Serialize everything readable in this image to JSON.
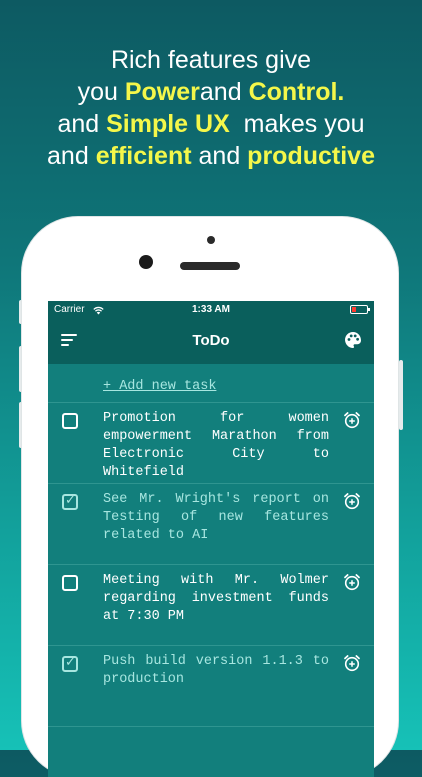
{
  "headline": {
    "line1": "Rich features give",
    "line2_a": "you ",
    "line2_power": "Power",
    "line2_b": "and ",
    "line2_control": "Control.",
    "line3_a": "and ",
    "line3_simple": "Simple UX",
    "line3_b": "  makes you",
    "line4_a": "and ",
    "line4_efficient": "efficient",
    "line4_b": " and ",
    "line4_productive": "productive"
  },
  "statusbar": {
    "carrier": "Carrier",
    "time": "1:33 AM"
  },
  "navbar": {
    "title": "ToDo",
    "menu_icon": "menu-icon",
    "palette_icon": "palette-icon"
  },
  "add_task": "+ Add new task",
  "tasks": [
    {
      "text": "Promotion for women empowerment Marathon from Electronic City to Whitefield",
      "done": false
    },
    {
      "text": "See Mr. Wright's report on Testing of new features related to AI",
      "done": true
    },
    {
      "text": "Meeting with Mr. Wolmer regarding investment funds at 7:30 PM",
      "done": false
    },
    {
      "text": "Push build version 1.1.3 to production",
      "done": true
    }
  ],
  "colors": {
    "accent_yellow": "#f4f74a",
    "app_teal": "#127f7c",
    "bar_teal": "#0a5f5c",
    "done_text": "#a7e6e0"
  }
}
